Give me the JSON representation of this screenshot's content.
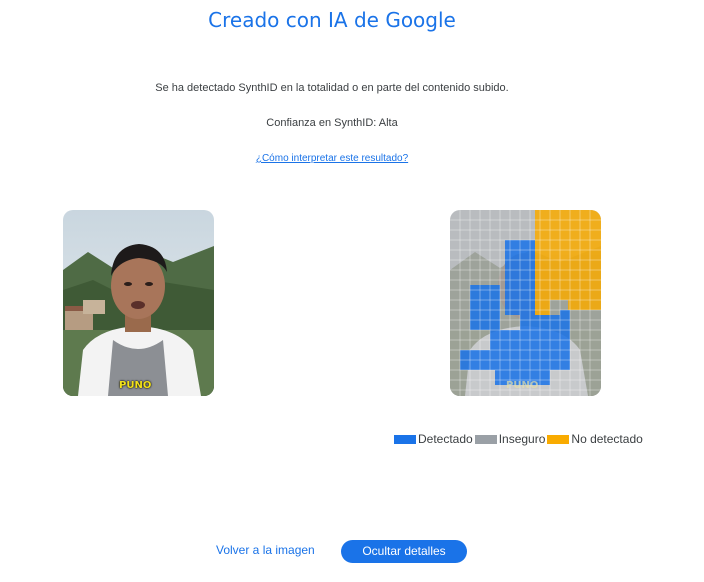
{
  "result": {
    "title": "Creado con IA de Google",
    "detection_text": "Se ha detectado SynthID en la totalidad o en parte del contenido subido.",
    "confidence_text": "Confianza en SynthID: Alta",
    "help_link": "¿Cómo interpretar este resultado?"
  },
  "images": {
    "caption_left": "PUNO",
    "caption_right": "PUNO"
  },
  "legend": {
    "detected": "Detectado",
    "unsure": "Inseguro",
    "not_detected": "No detectado"
  },
  "colors": {
    "detected": "#1a73e8",
    "unsure": "#9aa0a6",
    "not_detected": "#f9ab00",
    "accent": "#1a73e8"
  },
  "actions": {
    "back_to_image": "Volver a la imagen",
    "hide_details": "Ocultar detalles"
  }
}
